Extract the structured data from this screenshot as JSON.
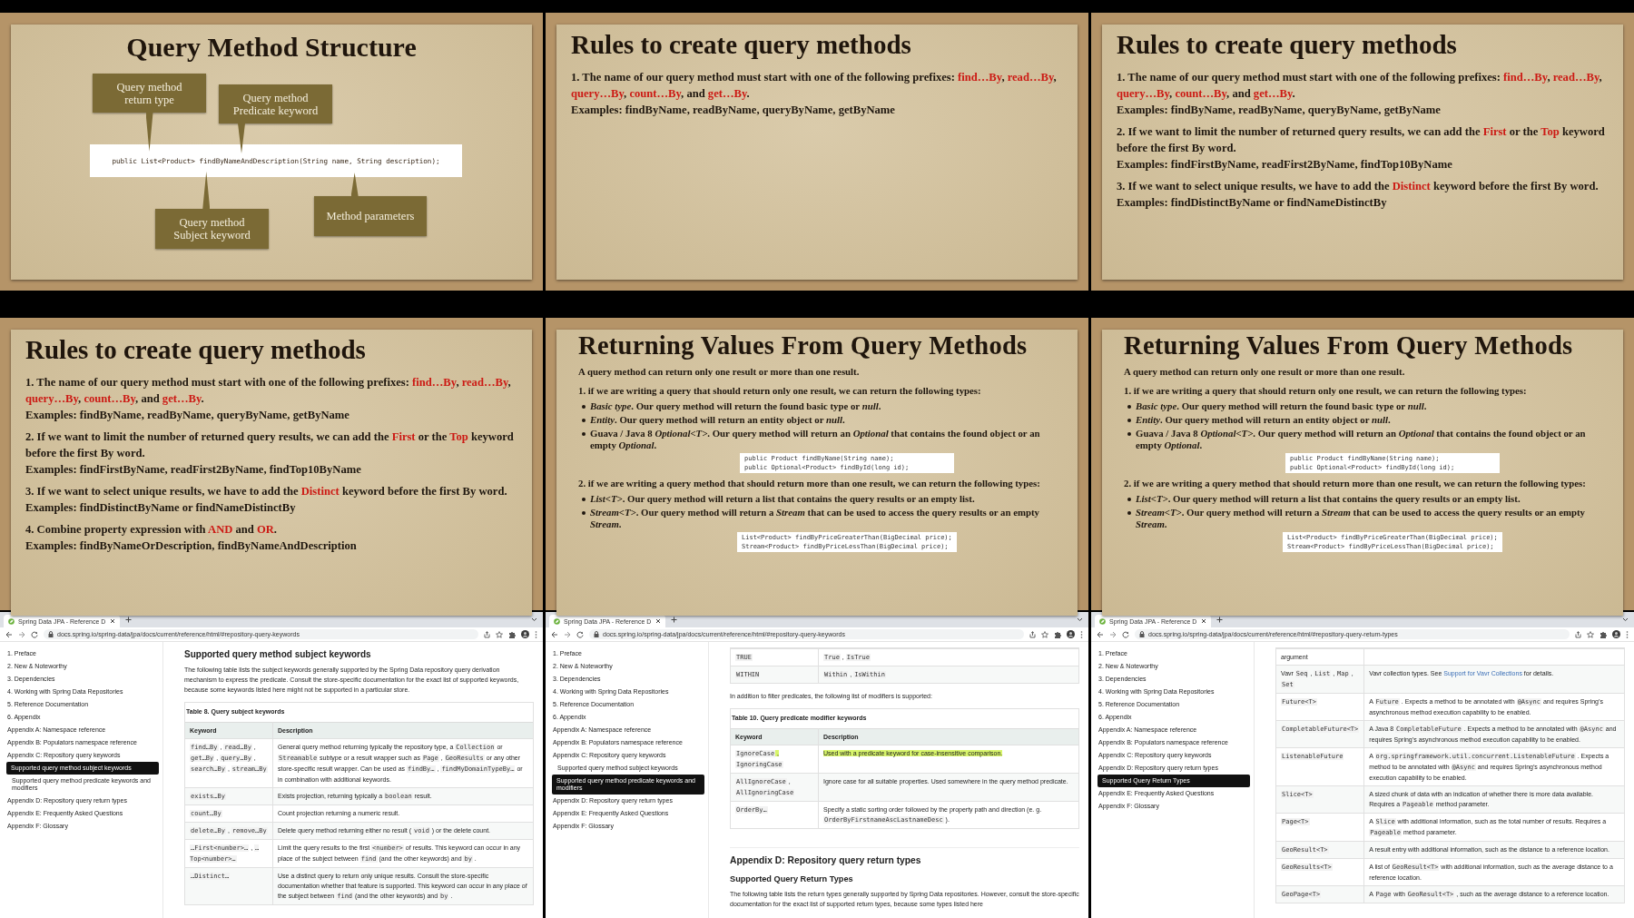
{
  "frames": [
    {
      "kind": "callouts",
      "title": "Query Method Structure",
      "code": "public List<Product> findByNameAndDescription(String name, String description);",
      "callouts": [
        {
          "text": "Query method\nreturn type",
          "points_up": false
        },
        {
          "text": "Query method\nPredicate keyword",
          "points_up": false
        },
        {
          "text": "Query method\nSubject keyword",
          "points_up": true
        },
        {
          "text": "Method parameters",
          "points_up": true
        }
      ]
    },
    {
      "kind": "rules",
      "title": "Rules to create query methods",
      "rules": [
        {
          "parts": [
            "1. The name of our query method must start with one of the following prefixes: ",
            {
              "keyword": "find…By"
            },
            ", ",
            {
              "keyword": "read…By"
            },
            ", ",
            {
              "keyword": "query…By"
            },
            ", ",
            {
              "keyword": "count…By"
            },
            ", and ",
            {
              "keyword": "get…By"
            },
            "."
          ],
          "examples": "Examples: findByName, readByName, queryByName, getByName"
        }
      ]
    },
    {
      "kind": "rules",
      "title": "Rules to create query methods",
      "rules": [
        {
          "parts": [
            "1. The name of our query method must start with one of the following prefixes: ",
            {
              "keyword": "find…By"
            },
            ", ",
            {
              "keyword": "read…By"
            },
            ", ",
            {
              "keyword": "query…By"
            },
            ", ",
            {
              "keyword": "count…By"
            },
            ", and ",
            {
              "keyword": "get…By"
            },
            "."
          ],
          "examples": "Examples: findByName, readByName, queryByName, getByName"
        },
        {
          "parts": [
            "2. If we want to limit the number of returned query results, we can add the ",
            {
              "keyword": "First"
            },
            " or the ",
            {
              "keyword": "Top"
            },
            " keyword before the first By word."
          ],
          "examples": "Examples:  findFirstByName, readFirst2ByName, findTop10ByName"
        },
        {
          "parts": [
            "3. If we want to select unique results, we have to add the ",
            {
              "keyword": "Distinct"
            },
            " keyword before the first By word."
          ],
          "examples": "Examples:  findDistinctByName or findNameDistinctBy"
        }
      ]
    },
    {
      "kind": "rules",
      "title": "Rules to create query methods",
      "rules": [
        {
          "parts": [
            "1. The name of our query method must start with one of the following prefixes: ",
            {
              "keyword": "find…By"
            },
            ", ",
            {
              "keyword": "read…By"
            },
            ", ",
            {
              "keyword": "query…By"
            },
            ", ",
            {
              "keyword": "count…By"
            },
            ", and ",
            {
              "keyword": "get…By"
            },
            "."
          ],
          "examples": "Examples: findByName, readByName, queryByName, getByName"
        },
        {
          "parts": [
            "2. If we want to limit the number of returned query results, we can add the ",
            {
              "keyword": "First"
            },
            " or the ",
            {
              "keyword": "Top"
            },
            " keyword before the first By word."
          ],
          "examples": "Examples:  findFirstByName, readFirst2ByName, findTop10ByName"
        },
        {
          "parts": [
            "3. If we want to select unique results, we have to add the ",
            {
              "keyword": "Distinct"
            },
            " keyword before the first By word."
          ],
          "examples": "Examples:  findDistinctByName or findNameDistinctBy"
        },
        {
          "parts": [
            "4. Combine property expression with ",
            {
              "keyword": "AND"
            },
            " and ",
            {
              "keyword": "OR"
            },
            "."
          ],
          "examples": "Examples: findByNameOrDescription, findByNameAndDescription"
        }
      ]
    },
    {
      "kind": "returning",
      "title": "Returning Values From Query Methods",
      "intro": "A query method can return only one result or more than one result.",
      "sections": [
        {
          "heading": "1. if we are writing a query that should return only one result, we can return the following types:",
          "bullets": [
            "*Basic type*. Our query method will return the found basic type or *null*.",
            "*Entity*. Our query method will return an entity object or *null*.",
            "Guava / Java 8 *Optional<T>*. Our query method will return an *Optional* that contains the found object or an empty *Optional*."
          ],
          "code": [
            "public Product findByName(String name);",
            "public Optional<Product> findById(long id);"
          ]
        },
        {
          "heading": "2. if we are writing a query method that should return more than one result, we can return the following types:",
          "bullets": [
            "*List<T>*. Our query method will return a list that contains the query results or an empty list.",
            "*Stream<T>*. Our query method will return a *Stream* that can be used to access the query results or an empty *Stream*."
          ],
          "code": [
            "List<Product> findByPriceGreaterThan(BigDecimal price);",
            "Stream<Product> findByPriceLessThan(BigDecimal price);"
          ]
        }
      ]
    },
    {
      "kind": "returning",
      "title": "Returning Values From Query Methods",
      "intro": "A query method can return only one result or more than one result.",
      "sections": [
        {
          "heading": "1. if we are writing a query that should return only one result, we can return the following types:",
          "bullets": [
            "*Basic type*. Our query method will return the found basic type or *null*.",
            "*Entity*. Our query method will return an entity object or *null*.",
            "Guava / Java 8 *Optional<T>*. Our query method will return an *Optional* that contains the found object or an empty *Optional*."
          ],
          "code": [
            "public Product findByName(String name);",
            "public Optional<Product> findById(long id);"
          ]
        },
        {
          "heading": "2. if we are writing a query method that should return more than one result, we can return the following types:",
          "bullets": [
            "*List<T>*. Our query method will return a list that contains the query results or an empty list.",
            "*Stream<T>*. Our query method will return a *Stream* that can be used to access the query results or an empty *Stream*."
          ],
          "code": [
            "List<Product> findByPriceGreaterThan(BigDecimal price);",
            "Stream<Product> findByPriceLessThan(BigDecimal price);"
          ]
        }
      ]
    },
    {
      "kind": "browser",
      "tab": "Spring Data JPA - Reference D",
      "url": "docs.spring.io/spring-data/jpa/docs/current/reference/html/#repository-query-keywords",
      "sidebar": {
        "items": [
          {
            "label": "1. Preface",
            "selected": false
          },
          {
            "label": "2. New & Noteworthy",
            "selected": false
          },
          {
            "label": "3. Dependencies",
            "selected": false
          },
          {
            "label": "4. Working with Spring Data Repositories",
            "selected": false
          },
          {
            "label": "5. Reference Documentation",
            "selected": false
          },
          {
            "label": "6. Appendix",
            "selected": false
          },
          {
            "label": "Appendix A: Namespace reference",
            "selected": false
          },
          {
            "label": "Appendix B: Populators namespace reference",
            "selected": false
          },
          {
            "label": "Appendix C: Repository query keywords",
            "selected": false,
            "children": [
              {
                "label": "Supported query method subject keywords",
                "selected": true
              },
              {
                "label": "Supported query method predicate keywords and modifiers",
                "selected": false
              }
            ]
          },
          {
            "label": "Appendix D: Repository query return types",
            "selected": false
          },
          {
            "label": "Appendix E: Frequently Asked Questions",
            "selected": false
          },
          {
            "label": "Appendix F: Glossary",
            "selected": false
          }
        ]
      },
      "content": [
        {
          "kind": "heading",
          "text": "Supported query method subject keywords"
        },
        {
          "kind": "paragraph",
          "text": "The following table lists the subject keywords generally supported by the Spring Data repository query derivation mechanism to express the predicate. Consult the store-specific documentation for the exact list of supported keywords, because some keywords listed here might not be supported in a particular store."
        },
        {
          "kind": "table",
          "caption": "Table 8. Query subject keywords",
          "columns": [
            "Keyword",
            "Description"
          ],
          "rows": [
            {
              "keyword": [
                {
                  "code": "find…By"
                },
                " , ",
                {
                  "code": "read…By"
                },
                " , ",
                {
                  "code": "get…By"
                },
                " , ",
                {
                  "code": "query…By"
                },
                " , ",
                {
                  "code": "search…By"
                },
                " , ",
                {
                  "code": "stream…By"
                }
              ],
              "description": [
                "General query method returning typically the repository type, a ",
                {
                  "code": "Collection"
                },
                " or ",
                {
                  "code": "Streamable"
                },
                " subtype or a result wrapper such as ",
                {
                  "code": "Page"
                },
                " , ",
                {
                  "code": "GeoResults"
                },
                " or any other store-specific result wrapper. Can be used as ",
                {
                  "code": "findBy…"
                },
                " , ",
                {
                  "code": "findMyDomainTypeBy…"
                },
                " or in combination with additional keywords."
              ]
            },
            {
              "keyword": [
                {
                  "code": "exists…By"
                }
              ],
              "description": [
                "Exists projection, returning typically a ",
                {
                  "code": "boolean"
                },
                " result."
              ]
            },
            {
              "keyword": [
                {
                  "code": "count…By"
                }
              ],
              "description": [
                "Count projection returning a numeric result."
              ]
            },
            {
              "keyword": [
                {
                  "code": "delete…By"
                },
                " , ",
                {
                  "code": "remove…By"
                }
              ],
              "description": [
                "Delete query method returning either no result ( ",
                {
                  "code": "void"
                },
                " ) or the delete count."
              ]
            },
            {
              "keyword": [
                {
                  "code": "…First<number>…"
                },
                " , ",
                {
                  "code": "…Top<number>…"
                }
              ],
              "description": [
                "Limit the query results to the first ",
                {
                  "code": "<number>"
                },
                " of results. This keyword can occur in any place of the subject between ",
                {
                  "code": "find"
                },
                " (and the other keywords) and ",
                {
                  "code": "by"
                },
                " ."
              ]
            },
            {
              "keyword": [
                {
                  "code": "…Distinct…"
                }
              ],
              "description": [
                "Use a distinct query to return only unique results. Consult the store-specific documentation whether that feature is supported. This keyword can occur in any place of the subject between ",
                {
                  "code": "find"
                },
                " (and the other keywords) and ",
                {
                  "code": "by"
                },
                " ."
              ]
            }
          ]
        }
      ]
    },
    {
      "kind": "browser",
      "tab": "Spring Data JPA - Reference D",
      "url": "docs.spring.io/spring-data/jpa/docs/current/reference/html/#repository-query-keywords",
      "sidebar": {
        "items": [
          {
            "label": "1. Preface",
            "selected": false
          },
          {
            "label": "2. New & Noteworthy",
            "selected": false
          },
          {
            "label": "3. Dependencies",
            "selected": false
          },
          {
            "label": "4. Working with Spring Data Repositories",
            "selected": false
          },
          {
            "label": "5. Reference Documentation",
            "selected": false
          },
          {
            "label": "6. Appendix",
            "selected": false
          },
          {
            "label": "Appendix A: Namespace reference",
            "selected": false
          },
          {
            "label": "Appendix B: Populators namespace reference",
            "selected": false
          },
          {
            "label": "Appendix C: Repository query keywords",
            "selected": false,
            "children": [
              {
                "label": "Supported query method subject keywords",
                "selected": false
              },
              {
                "label": "Supported query method predicate keywords and modifiers",
                "selected": true
              }
            ]
          },
          {
            "label": "Appendix D: Repository query return types",
            "selected": false
          },
          {
            "label": "Appendix E: Frequently Asked Questions",
            "selected": false
          },
          {
            "label": "Appendix F: Glossary",
            "selected": false
          }
        ]
      },
      "content": [
        {
          "kind": "table",
          "rows": [
            {
              "keyword": [
                {
                  "code": "TRUE"
                }
              ],
              "description": [
                {
                  "code": "True"
                },
                " , ",
                {
                  "code": "IsTrue"
                }
              ]
            },
            {
              "keyword": [
                {
                  "code": "WITHIN"
                }
              ],
              "description": [
                {
                  "code": "Within"
                },
                " , ",
                {
                  "code": "IsWithin"
                }
              ]
            }
          ]
        },
        {
          "kind": "paragraph",
          "text": "In addition to filter predicates, the following list of modifiers is supported:"
        },
        {
          "kind": "table",
          "caption": "Table 10. Query predicate modifier keywords",
          "columns": [
            "Keyword",
            "Description"
          ],
          "rows": [
            {
              "highlighted": true,
              "keyword": [
                {
                  "code": "IgnoreCase"
                },
                " , ",
                {
                  "code": "IgnoringCase"
                }
              ],
              "description": [
                "Used with a predicate keyword for case-insensitive comparison."
              ]
            },
            {
              "highlighted": false,
              "keyword": [
                {
                  "code": "AllIgnoreCase"
                },
                " , ",
                {
                  "code": "AllIgnoringCase"
                }
              ],
              "description": [
                "Ignore case for all suitable properties. Used somewhere in the query method predicate."
              ]
            },
            {
              "highlighted": false,
              "keyword": [
                {
                  "code": "OrderBy…"
                }
              ],
              "description": [
                "Specify a static sorting order followed by the property path and direction (e. g. ",
                {
                  "code": "OrderByFirstnameAscLastnameDesc"
                },
                " )."
              ]
            }
          ]
        },
        {
          "kind": "section-heading",
          "text": "Appendix D: Repository query return types"
        },
        {
          "kind": "subheading",
          "text": "Supported Query Return Types"
        },
        {
          "kind": "paragraph",
          "text": "The following table lists the return types generally supported by Spring Data repositories. However, consult the store-specific documentation for the exact list of supported return types, because some types listed here"
        }
      ]
    },
    {
      "kind": "browser",
      "tab": "Spring Data JPA - Reference D",
      "url": "docs.spring.io/spring-data/jpa/docs/current/reference/html/#repository-query-return-types",
      "sidebar": {
        "items": [
          {
            "label": "1. Preface",
            "selected": false
          },
          {
            "label": "2. New & Noteworthy",
            "selected": false
          },
          {
            "label": "3. Dependencies",
            "selected": false
          },
          {
            "label": "4. Working with Spring Data Repositories",
            "selected": false
          },
          {
            "label": "5. Reference Documentation",
            "selected": false
          },
          {
            "label": "6. Appendix",
            "selected": false
          },
          {
            "label": "Appendix A: Namespace reference",
            "selected": false
          },
          {
            "label": "Appendix B: Populators namespace reference",
            "selected": false
          },
          {
            "label": "Appendix C: Repository query keywords",
            "selected": false
          },
          {
            "label": "Appendix D: Repository query return types",
            "selected": false,
            "children": [
              {
                "label": "Supported Query Return Types",
                "selected": true
              }
            ]
          },
          {
            "label": "Appendix E: Frequently Asked Questions",
            "selected": false
          },
          {
            "label": "Appendix F: Glossary",
            "selected": false
          }
        ]
      },
      "content": [
        {
          "kind": "table",
          "rows": [
            {
              "keyword": [
                "argument"
              ],
              "description": []
            },
            {
              "keyword": [
                "Vavr ",
                {
                  "code": "Seq"
                },
                " , ",
                {
                  "code": "List"
                },
                " , ",
                {
                  "code": "Map"
                },
                " , ",
                {
                  "code": "Set"
                }
              ],
              "description": [
                "Vavr collection types. See ",
                {
                  "link": "Support for Vavr Collections"
                },
                " for details."
              ]
            },
            {
              "keyword": [
                {
                  "code": "Future<T>"
                }
              ],
              "description": [
                "A ",
                {
                  "code": "Future"
                },
                " . Expects a method to be annotated with ",
                {
                  "code": "@Async"
                },
                " and requires Spring’s asynchronous method execution capability to be enabled."
              ]
            },
            {
              "keyword": [
                {
                  "code": "CompletableFuture<T>"
                }
              ],
              "description": [
                "A Java 8 ",
                {
                  "code": "CompletableFuture"
                },
                " . Expects a method to be annotated with ",
                {
                  "code": "@Async"
                },
                " and requires Spring’s asynchronous method execution capability to be enabled."
              ]
            },
            {
              "keyword": [
                {
                  "code": "ListenableFuture"
                }
              ],
              "description": [
                "A ",
                {
                  "code": "org.springframework.util.concurrent.ListenableFuture"
                },
                " . Expects a method to be annotated with ",
                {
                  "code": "@Async"
                },
                " and requires Spring’s asynchronous method execution capability to be enabled."
              ]
            },
            {
              "keyword": [
                {
                  "code": "Slice<T>"
                }
              ],
              "description": [
                "A sized chunk of data with an indication of whether there is more data available. Requires a ",
                {
                  "code": "Pageable"
                },
                " method parameter."
              ]
            },
            {
              "keyword": [
                {
                  "code": "Page<T>"
                }
              ],
              "description": [
                "A ",
                {
                  "code": "Slice"
                },
                " with additional information, such as the total number of results. Requires a ",
                {
                  "code": "Pageable"
                },
                " method parameter."
              ]
            },
            {
              "keyword": [
                {
                  "code": "GeoResult<T>"
                }
              ],
              "description": [
                "A result entry with additional information, such as the distance to a reference location."
              ]
            },
            {
              "keyword": [
                {
                  "code": "GeoResults<T>"
                }
              ],
              "description": [
                "A list of ",
                {
                  "code": "GeoResult<T>"
                },
                " with additional information, such as the average distance to a reference location."
              ]
            },
            {
              "keyword": [
                {
                  "code": "GeoPage<T>"
                }
              ],
              "description": [
                "A ",
                {
                  "code": "Page"
                },
                " with ",
                {
                  "code": "GeoResult<T>"
                },
                " , such as the average distance to a reference location."
              ]
            }
          ]
        }
      ]
    }
  ]
}
